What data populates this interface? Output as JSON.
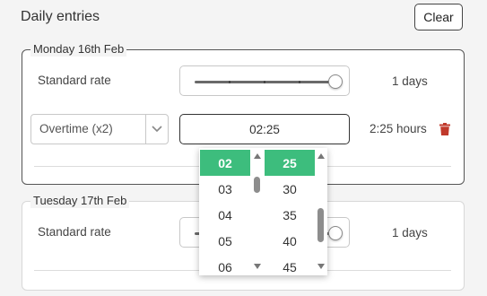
{
  "panel": {
    "title": "Daily entries",
    "clear_label": "Clear"
  },
  "days": [
    {
      "date_label": "Monday 16th Feb",
      "standard": {
        "label": "Standard rate",
        "value": "1 days",
        "slider_fraction": 1.0
      },
      "overtime": {
        "type_value": "Overtime (x2)",
        "time_value": "02:25",
        "duration": "2:25 hours"
      }
    },
    {
      "date_label": "Tuesday 17th Feb",
      "standard": {
        "label": "Standard rate",
        "value": "1 days"
      }
    }
  ],
  "time_picker": {
    "hours": [
      "02",
      "03",
      "04",
      "05",
      "06"
    ],
    "selected_hour": "02",
    "minutes": [
      "25",
      "30",
      "35",
      "40",
      "45"
    ],
    "selected_minute": "25"
  },
  "colors": {
    "accent": "#3dbd7d",
    "delete": "#c0392b"
  },
  "icons": {
    "select_arrow": "chevron-down-icon",
    "delete": "trash-icon"
  }
}
